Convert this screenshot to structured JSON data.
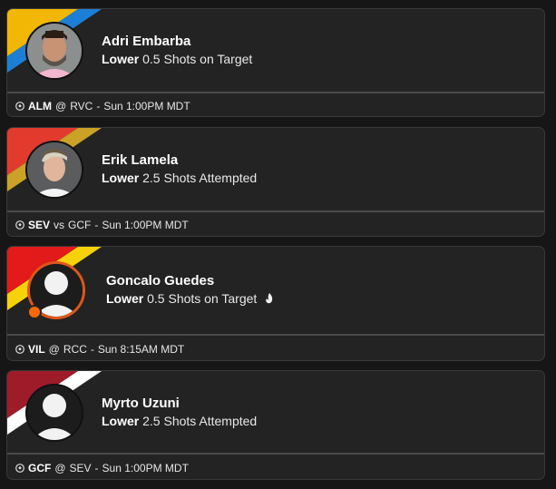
{
  "cards": [
    {
      "player": "Adri Embarba",
      "direction": "Lower",
      "line": "0.5 Shots on Target",
      "matchup": {
        "team": "ALM",
        "sep": "@",
        "opponent": "RVC",
        "time": "Sun 1:00PM MDT"
      },
      "stripe_colors": [
        "#f2b705",
        "#1c7fd6"
      ],
      "avatar": "player-photo"
    },
    {
      "player": "Erik Lamela",
      "direction": "Lower",
      "line": "2.5 Shots Attempted",
      "matchup": {
        "team": "SEV",
        "sep": "vs",
        "opponent": "GCF",
        "time": "Sun 1:00PM MDT"
      },
      "stripe_colors": [
        "#e23b2e",
        "#c9a227"
      ],
      "avatar": "player-photo"
    },
    {
      "player": "Goncalo Guedes",
      "direction": "Lower",
      "line": "0.5 Shots on Target",
      "matchup": {
        "team": "VIL",
        "sep": "@",
        "opponent": "RCC",
        "time": "Sun 8:15AM MDT"
      },
      "stripe_colors": [
        "#e21a1a",
        "#f5d20a"
      ],
      "avatar": "placeholder-silhouette",
      "has_flame": true
    },
    {
      "player": "Myrto Uzuni",
      "direction": "Lower",
      "line": "2.5 Shots Attempted",
      "matchup": {
        "team": "GCF",
        "sep": "@",
        "opponent": "SEV",
        "time": "Sun 1:00PM MDT"
      },
      "stripe_colors": [
        "#9e1b2a",
        "#ffffff"
      ],
      "avatar": "placeholder-silhouette"
    }
  ]
}
